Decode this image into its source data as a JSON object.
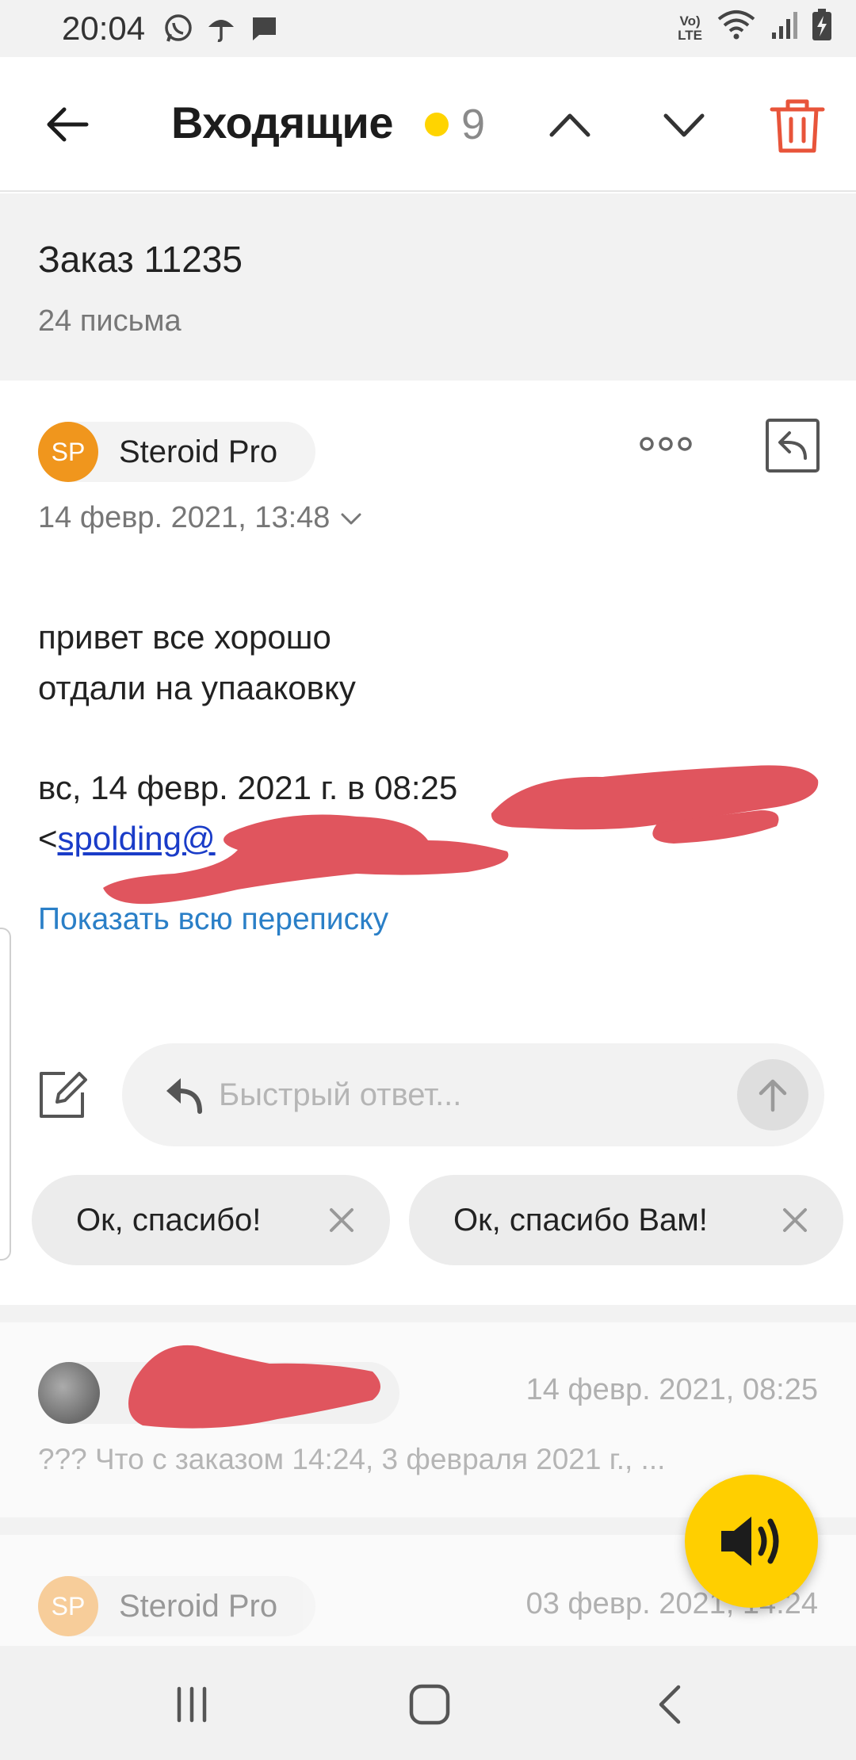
{
  "status_bar": {
    "time": "20:04",
    "lte_line1": "Vo)",
    "lte_line2": "LTE",
    "icons": [
      "whatsapp-icon",
      "umbrella-icon",
      "message-icon",
      "volte-icon",
      "wifi-icon",
      "signal-icon",
      "battery-charging-icon"
    ]
  },
  "toolbar": {
    "title": "Входящие",
    "unread_count": "9",
    "unread_dot_color": "#ffd400",
    "delete_color": "#e8543a"
  },
  "thread": {
    "subject": "Заказ 11235",
    "count": "24 письма"
  },
  "message": {
    "avatar_initials": "SP",
    "avatar_color": "#f0961d",
    "sender": "Steroid Pro",
    "date": "14 февр. 2021, 13:48",
    "body_line1": "привет все хорошо",
    "body_line2": "отдали на упааковку",
    "quote_line1": "вс, 14 февр. 2021 г. в 08:25",
    "quote_prefix": "<",
    "quote_email": "spolding@",
    "show_all": "Показать всю переписку"
  },
  "quick_reply": {
    "placeholder": "Быстрый ответ...",
    "suggestions": [
      "Ок, спасибо!",
      "Ок, спасибо Вам!"
    ]
  },
  "collapsed_messages": [
    {
      "date": "14 февр. 2021, 08:25",
      "preview": "??? Что с заказом 14:24, 3 февраля 2021 г., ..."
    },
    {
      "avatar_initials": "SP",
      "sender": "Steroid Pro",
      "date": "03 февр. 2021, 14:24"
    }
  ],
  "fab": {
    "icon": "speaker-icon",
    "color": "#ffcf00"
  },
  "nav_bar": {
    "icons": [
      "recent-apps-icon",
      "home-icon",
      "back-icon"
    ]
  }
}
